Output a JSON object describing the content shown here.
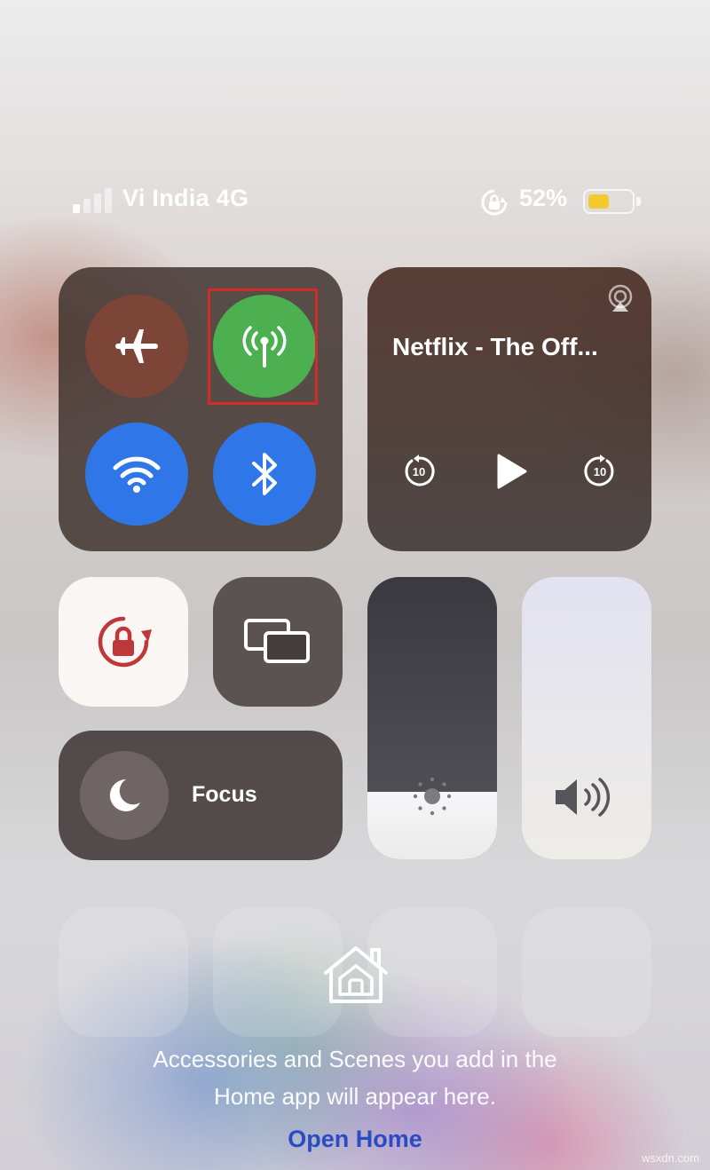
{
  "status_bar": {
    "carrier": "Vi India 4G",
    "battery_percent": "52%",
    "battery_level": 0.52,
    "signal_bars_active": 1,
    "signal_bars_total": 4,
    "icons": [
      "signal-icon",
      "orientation-lock-small-icon",
      "battery-icon"
    ],
    "battery_color": "#f3c92d"
  },
  "connectivity": {
    "buttons": [
      {
        "name": "airplane-mode-button",
        "icon": "airplane-icon",
        "active": false,
        "color": "#7d4537"
      },
      {
        "name": "cellular-data-button",
        "icon": "antenna-icon",
        "active": true,
        "color": "#4caf50",
        "highlighted": true
      },
      {
        "name": "wifi-button",
        "icon": "wifi-icon",
        "active": true,
        "color": "#2f77e8"
      },
      {
        "name": "bluetooth-button",
        "icon": "bluetooth-icon",
        "active": true,
        "color": "#2f77e8"
      }
    ],
    "highlight_color": "#d32b2b"
  },
  "now_playing": {
    "title": "Netflix - The Off...",
    "skip_seconds": "10",
    "controls": [
      "skip-back-icon",
      "play-icon",
      "skip-forward-icon"
    ],
    "airplay_icon": "airplay-icon"
  },
  "tiles": {
    "orientation_lock": {
      "icon": "orientation-lock-icon",
      "active": true,
      "icon_color": "#c0373b"
    },
    "screen_mirroring": {
      "icon": "screen-mirroring-icon"
    },
    "focus": {
      "label": "Focus",
      "icon": "moon-icon"
    }
  },
  "sliders": {
    "brightness": {
      "icon": "brightness-icon",
      "level": 0.24
    },
    "volume": {
      "icon": "volume-icon",
      "level": 1.0
    }
  },
  "home": {
    "icon": "home-icon",
    "message_line1": "Accessories and Scenes you add in the",
    "message_line2": "Home app will appear here.",
    "open_label": "Open Home"
  },
  "watermark": "wsxdn.com"
}
